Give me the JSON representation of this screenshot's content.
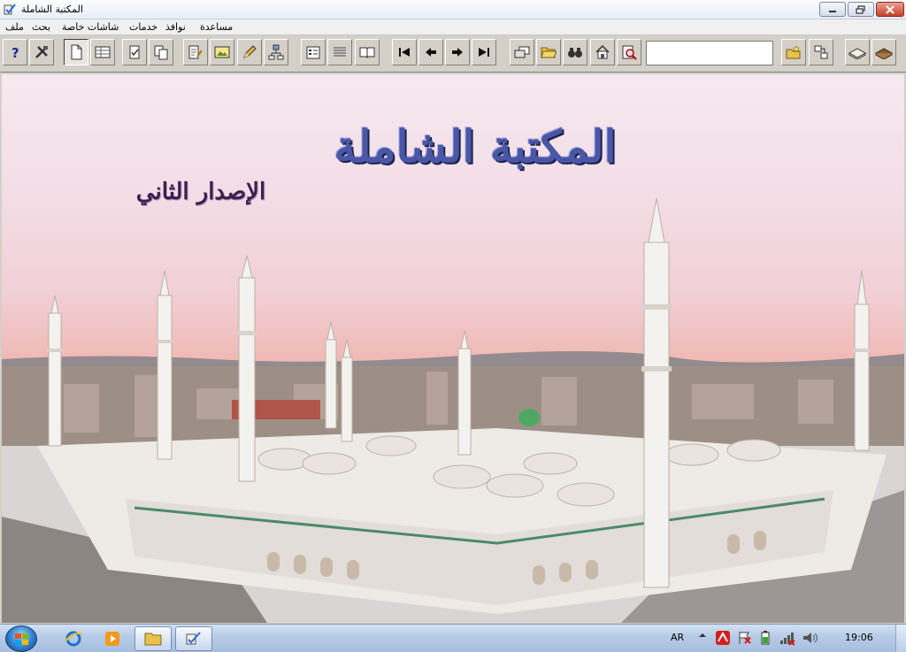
{
  "window": {
    "title": "المكتبة الشاملة",
    "icon": "app-book-check-icon",
    "controls": [
      "minimize-icon",
      "maximize-icon",
      "close-icon"
    ]
  },
  "menu": {
    "items": [
      {
        "label": "ملف"
      },
      {
        "label": "بحث"
      },
      {
        "label": "شاشات خاصة"
      },
      {
        "label": "خدمات"
      },
      {
        "label": "نوافذ"
      },
      {
        "label": "مساعدة"
      }
    ]
  },
  "toolbar": {
    "buttons": [
      "help-icon",
      "tools-icon",
      "new-document-icon",
      "table-icon",
      "check-document-icon",
      "copy-icon",
      "edit-document-icon",
      "image-icon",
      "pencil-icon",
      "tree-icon",
      "properties-icon",
      "list-icon",
      "book-open-icon",
      "first-icon",
      "previous-icon",
      "next-icon",
      "last-icon",
      "cards-icon",
      "open-folder-icon",
      "binoculars-icon",
      "house-icon",
      "search-page-icon",
      "new-folder-icon",
      "connect-icon",
      "open-book-icon",
      "closed-book-icon"
    ],
    "search_value": ""
  },
  "splash": {
    "title": "المكتبة الشاملة",
    "subtitle": "الإصدار الثاني",
    "background": "mosque-panorama"
  },
  "taskbar": {
    "start": "windows-start-icon",
    "apps": [
      "internet-explorer-icon",
      "media-player-icon",
      "folder-icon",
      "shamela-app-icon"
    ],
    "tray": {
      "language": "AR",
      "time": "19:06",
      "icons": [
        "show-hidden-icon",
        "antivirus-icon",
        "flag-icon",
        "battery-icon",
        "network-icon",
        "volume-icon"
      ]
    }
  },
  "colors": {
    "title_blue": "#4b57a6",
    "subtitle_purple": "#3e1f4d",
    "sky_pink": "#f1cfd6"
  }
}
